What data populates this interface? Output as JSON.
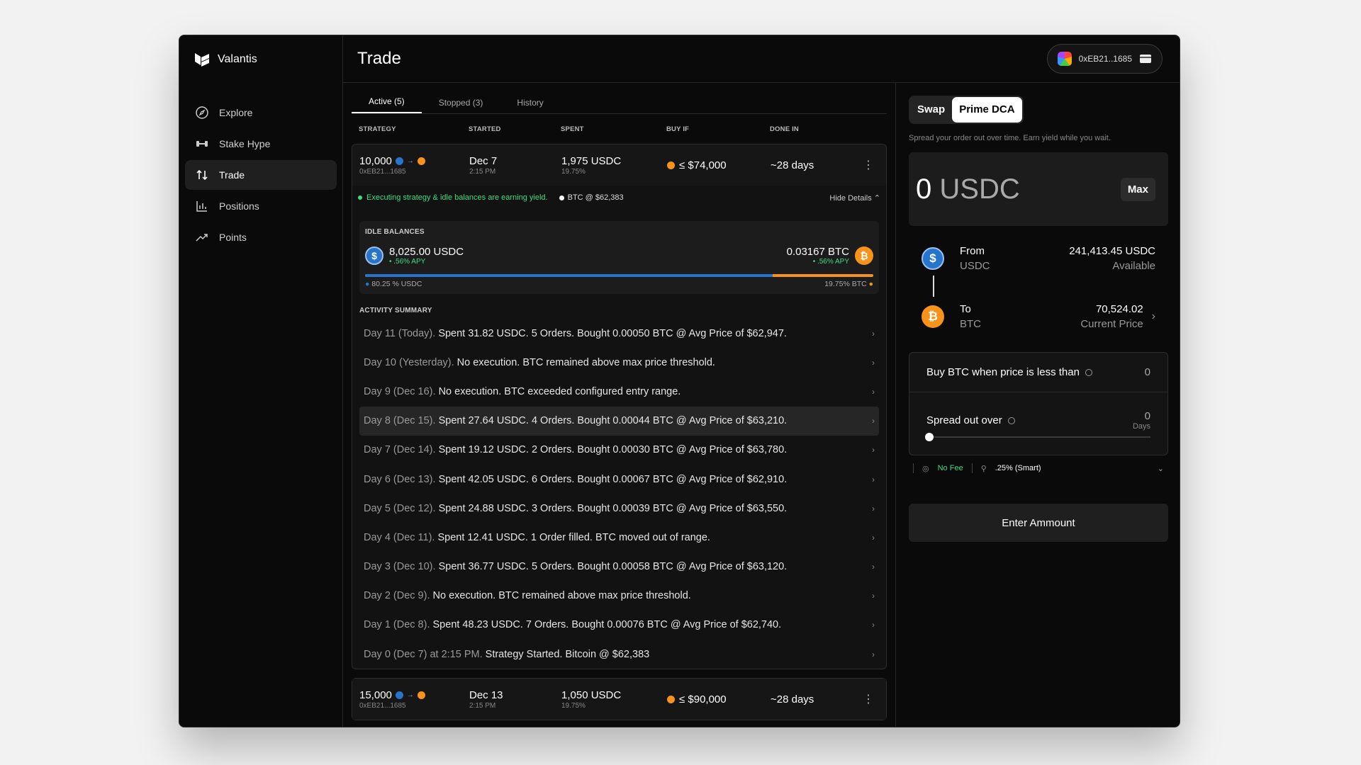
{
  "brand": {
    "name": "Valantis"
  },
  "nav": [
    {
      "label": "Explore",
      "icon": "compass-icon",
      "active": false
    },
    {
      "label": "Stake Hype",
      "icon": "dumbbell-icon",
      "active": false
    },
    {
      "label": "Trade",
      "icon": "swap-vertical-icon",
      "active": true
    },
    {
      "label": "Positions",
      "icon": "bar-chart-icon",
      "active": false
    },
    {
      "label": "Points",
      "icon": "trend-up-icon",
      "active": false
    }
  ],
  "header": {
    "title": "Trade",
    "wallet": "0xEB21..1685"
  },
  "tabs": [
    "Active (5)",
    "Stopped (3)",
    "History"
  ],
  "columns": {
    "strategy": "STRATEGY",
    "started": "STARTED",
    "spent": "SPENT",
    "buy_if": "BUY IF",
    "done_in": "DONE IN"
  },
  "strategy1": {
    "amount": "10,000",
    "address": "0xEB21...1685",
    "started": "Dec 7",
    "started_time": "2:15 PM",
    "spent": "1,975 USDC",
    "spent_pct": "19.75%",
    "buy_if": "≤  $74,000",
    "done_in": "~28 days",
    "exec_text": "Executing strategy & idle balances are earning yield.",
    "btc_price": "BTC @ $62,383",
    "hide_details": "Hide Details"
  },
  "idle": {
    "label": "IDLE BALANCES",
    "usdc_amount": "8,025.00 USDC",
    "usdc_apy": ".56% APY",
    "btc_amount": "0.03167 BTC",
    "btc_apy": ".56% APY",
    "usdc_share": 0.8025,
    "usdc_label": "80.25 % USDC",
    "btc_label": "19.75% BTC"
  },
  "activity": {
    "label": "ACTIVITY SUMMARY",
    "rows": [
      {
        "day": "Day 11 (Today).",
        "text": "Spent 31.82 USDC. 5 Orders. Bought 0.00050 BTC @ Avg Price of $62,947."
      },
      {
        "day": "Day 10 (Yesterday).",
        "text": "No execution. BTC remained above max price threshold."
      },
      {
        "day": "Day 9 (Dec 16).",
        "text": "No execution. BTC exceeded configured entry range."
      },
      {
        "day": "Day 8 (Dec 15).",
        "text": "Spent 27.64 USDC. 4 Orders. Bought 0.00044 BTC @ Avg Price of $63,210."
      },
      {
        "day": "Day 7 (Dec 14).",
        "text": "Spent 19.12 USDC. 2 Orders. Bought 0.00030 BTC @ Avg Price of $63,780."
      },
      {
        "day": "Day 6 (Dec 13).",
        "text": "Spent 42.05 USDC. 6 Orders. Bought 0.00067 BTC @ Avg Price of $62,910."
      },
      {
        "day": "Day 5 (Dec 12).",
        "text": "Spent 24.88 USDC. 3 Orders. Bought 0.00039 BTC @ Avg Price of $63,550."
      },
      {
        "day": "Day 4 (Dec 11).",
        "text": "Spent 12.41 USDC. 1 Order filled. BTC moved out of range."
      },
      {
        "day": "Day 3 (Dec 10).",
        "text": "Spent 36.77 USDC. 5 Orders. Bought 0.00058 BTC @ Avg Price of $63,120."
      },
      {
        "day": "Day 2 (Dec 9).",
        "text": "No execution. BTC remained above max price threshold."
      },
      {
        "day": "Day 1 (Dec 8).",
        "text": "Spent 48.23 USDC. 7 Orders. Bought 0.00076 BTC @ Avg Price of $62,740."
      },
      {
        "day": "Day 0 (Dec 7) at 2:15 PM.",
        "text": "Strategy Started. Bitcoin @ $62,383"
      }
    ]
  },
  "strategy2": {
    "amount": "15,000",
    "address": "0xEB21...1685",
    "started": "Dec 13",
    "started_time": "2:15 PM",
    "spent": "1,050 USDC",
    "spent_pct": "19.75%",
    "buy_if": "≤  $90,000",
    "done_in": "~28 days"
  },
  "panel": {
    "seg_swap": "Swap",
    "seg_dca": "Prime DCA",
    "tagline": "Spread your order out over time. Earn yield while you wait.",
    "amount_num": "0",
    "amount_unit": "USDC",
    "max": "Max",
    "from_label": "From",
    "from_token": "USDC",
    "from_amount": "241,413.45 USDC",
    "from_sub": "Available",
    "to_label": "To",
    "to_token": "BTC",
    "to_amount": "70,524.02",
    "to_sub": "Current Price",
    "buy_label": "Buy BTC when price is less than",
    "buy_value": "0",
    "spread_label": "Spread out over",
    "spread_value": "0",
    "spread_unit": "Days",
    "spread_fraction": 0,
    "no_fee": "No Fee",
    "slippage": ".25% (Smart)",
    "enter": "Enter Ammount"
  },
  "colors": {
    "usdc": "#2775ca",
    "btc": "#f7931a",
    "green": "#3ddc84"
  }
}
